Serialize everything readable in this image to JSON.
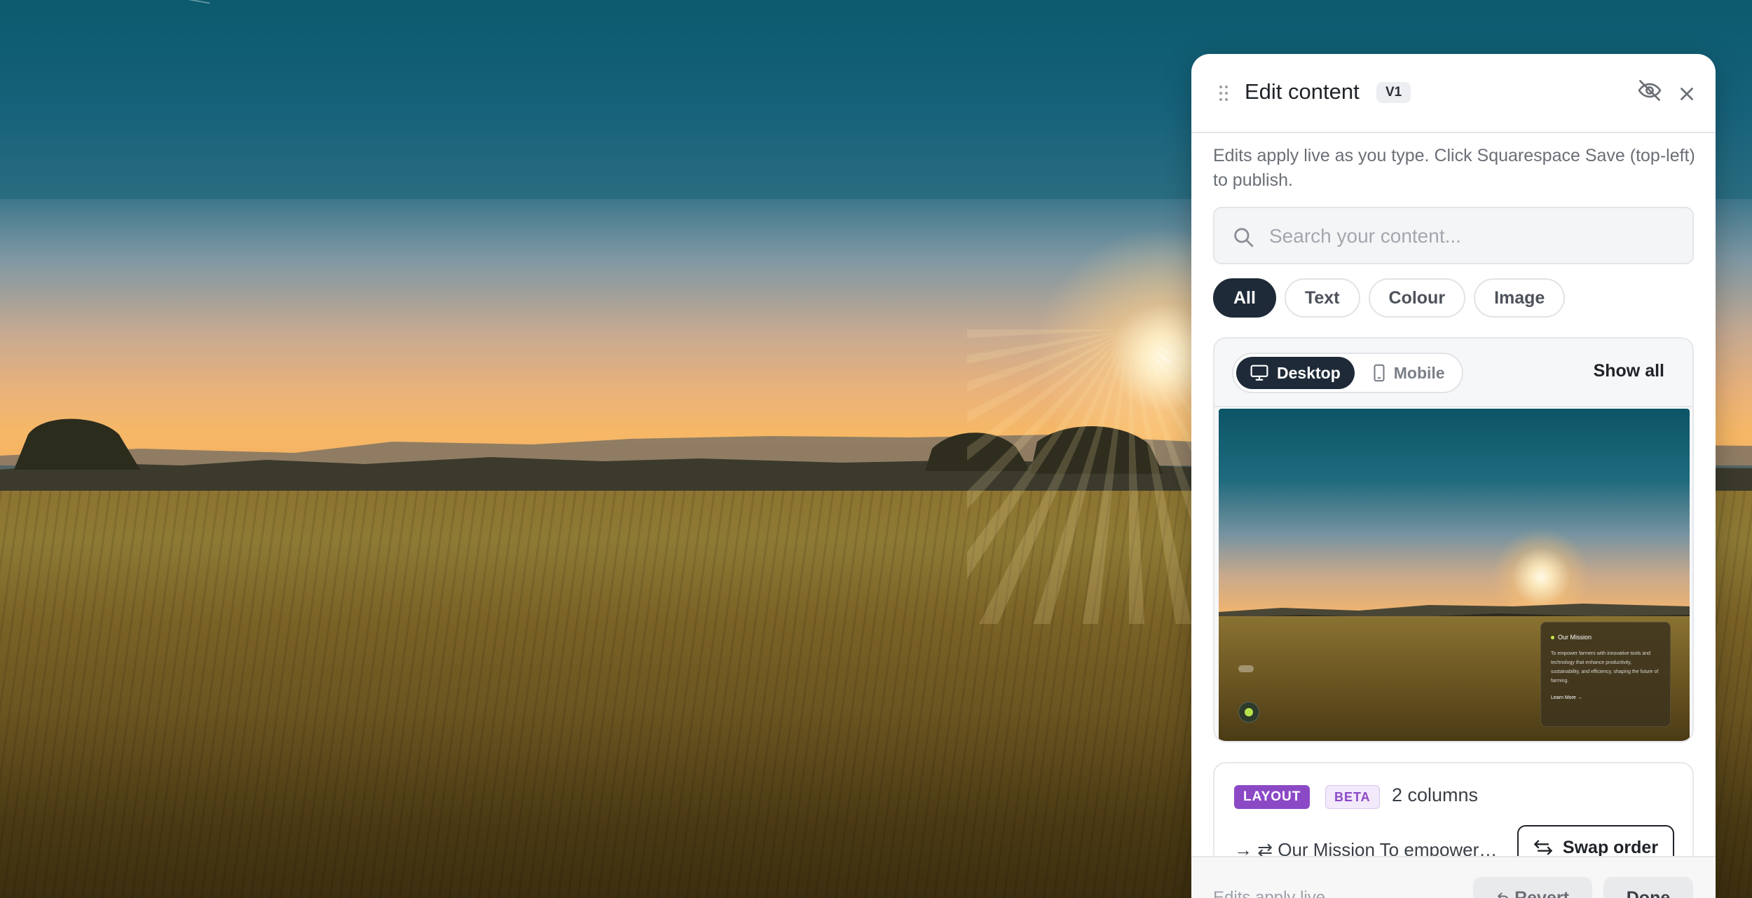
{
  "panel": {
    "title": "Edit content",
    "version": "V1",
    "hint": "Edits apply live as you type. Click Squarespace Save (top-left) to publish.",
    "search": {
      "placeholder": "Search your content...",
      "value": ""
    },
    "filters": [
      {
        "label": "All",
        "active": true
      },
      {
        "label": "Text",
        "active": false
      },
      {
        "label": "Colour",
        "active": false
      },
      {
        "label": "Image",
        "active": false
      }
    ],
    "preview": {
      "devices": [
        {
          "label": "Desktop",
          "icon": "desktop-icon",
          "active": true
        },
        {
          "label": "Mobile",
          "icon": "mobile-icon",
          "active": false
        }
      ],
      "show_all": "Show all",
      "thumbnail": {
        "card_title": "Our Mission",
        "card_body": "To empower farmers with innovative tools and technology that enhance productivity, sustainability, and efficiency, shaping the future of farming.",
        "card_link": "Learn More →"
      }
    },
    "layout": {
      "tag": "LAYOUT",
      "beta": "BETA",
      "columns": "2 columns",
      "row_text": "→ ⇄ Our Mission To empower fa...",
      "swap_label": "Swap order"
    },
    "footer": {
      "status": "Edits apply live",
      "revert_label": "Revert",
      "done_label": "Done"
    }
  },
  "colors": {
    "accent_dark": "#1e2a37",
    "layout_tag": "#8b49c6"
  }
}
